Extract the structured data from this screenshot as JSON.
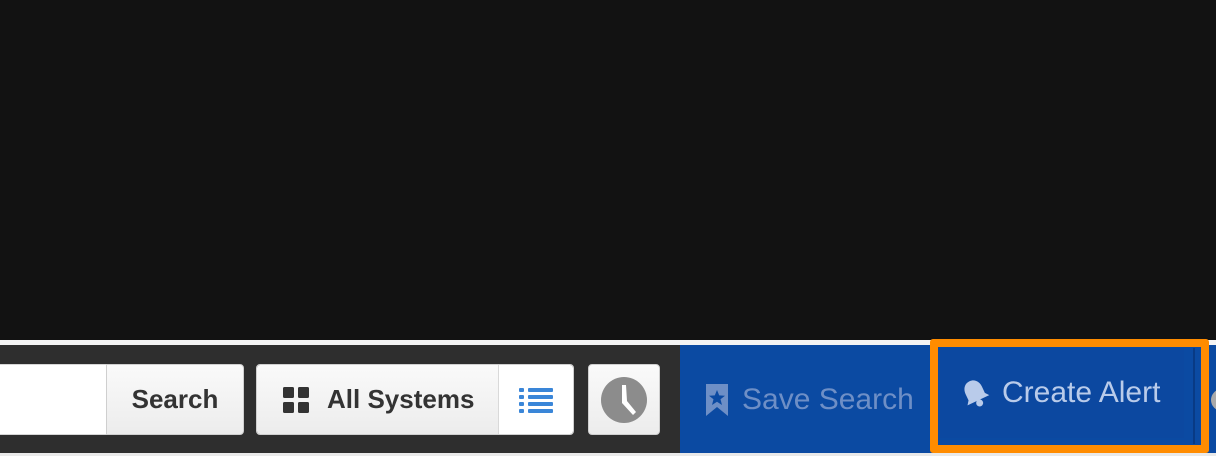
{
  "toolbar": {
    "search_label": "Search",
    "systems_label": "All Systems",
    "save_search_label": "Save Search",
    "create_alert_label": "Create Alert"
  },
  "icons": {
    "systems": "grid-icon",
    "list": "list-icon",
    "clock": "clock-icon",
    "save_search": "bookmark-star-icon",
    "create_alert": "bell-icon",
    "overflow": "gear-icon"
  },
  "colors": {
    "accent_blue": "#0b4aa2",
    "highlight_orange": "#ff8c00",
    "list_icon_blue": "#3a86d8"
  }
}
